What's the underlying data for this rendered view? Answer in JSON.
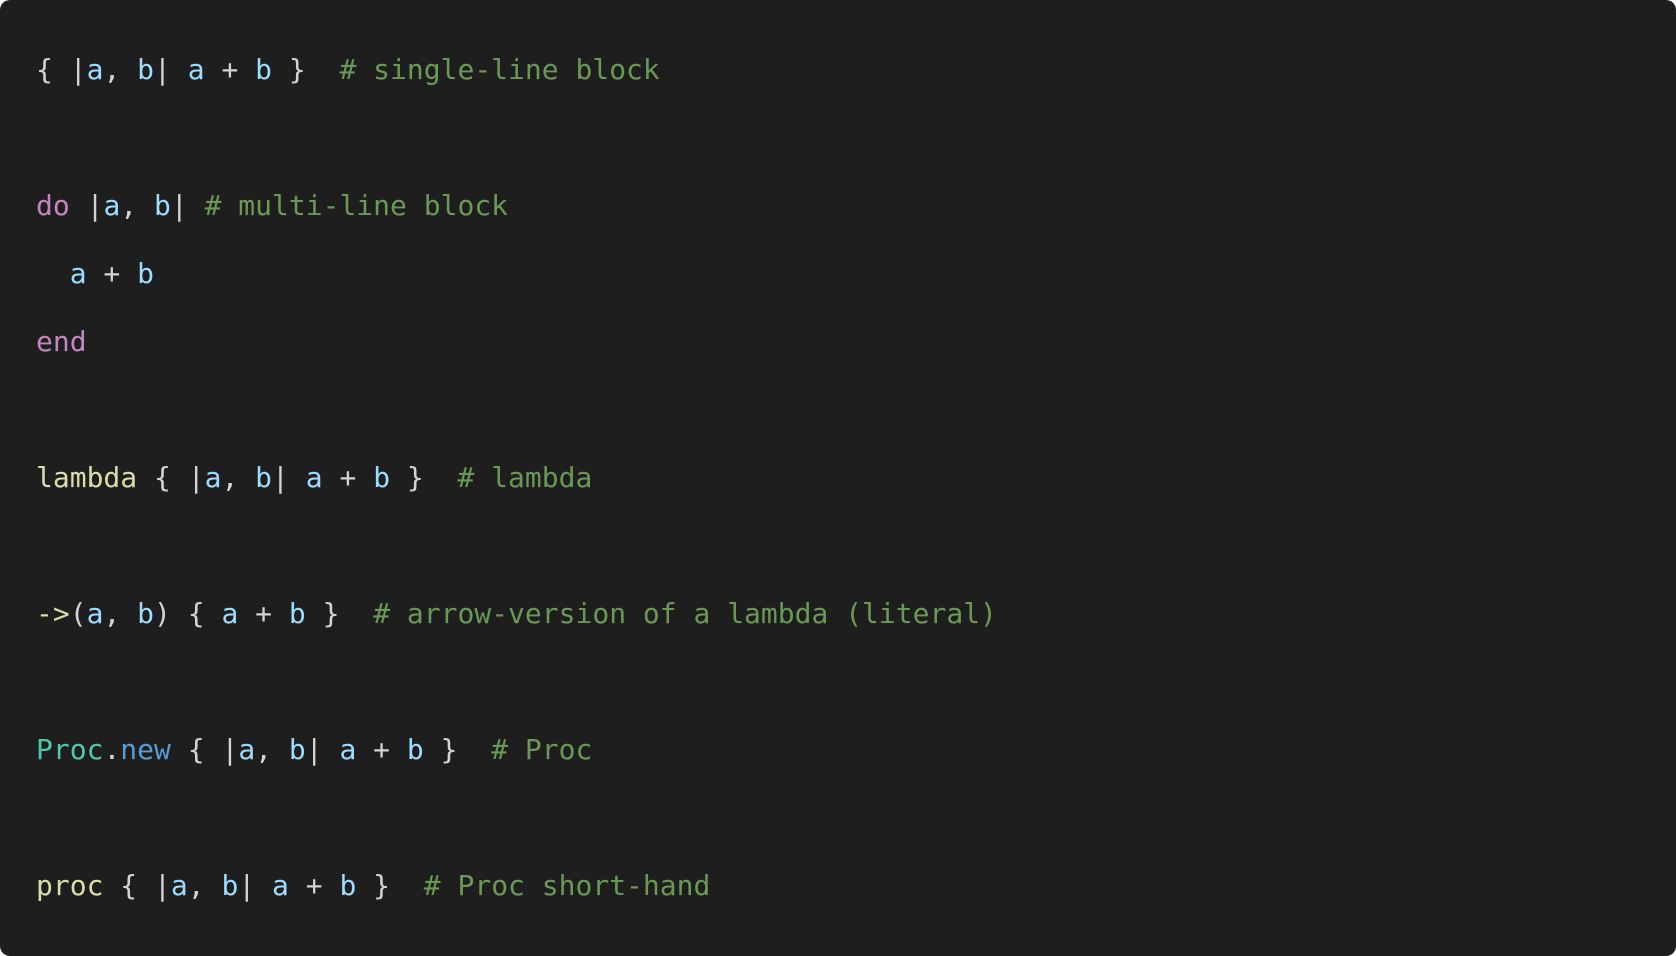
{
  "editor": {
    "language": "ruby",
    "theme_colors": {
      "background": "#1e1e1e",
      "punctuation": "#d4d4d4",
      "variable": "#9cdcfe",
      "comment": "#6a9955",
      "keyword": "#c586c0",
      "function": "#dcdcaa",
      "class": "#4ec9b0",
      "method": "#569cd6"
    },
    "lines": [
      {
        "tokens": [
          {
            "text": "{ |",
            "type": "punctuation"
          },
          {
            "text": "a",
            "type": "variable"
          },
          {
            "text": ", ",
            "type": "punctuation"
          },
          {
            "text": "b",
            "type": "variable"
          },
          {
            "text": "| ",
            "type": "punctuation"
          },
          {
            "text": "a",
            "type": "variable"
          },
          {
            "text": " + ",
            "type": "punctuation"
          },
          {
            "text": "b",
            "type": "variable"
          },
          {
            "text": " }  ",
            "type": "punctuation"
          },
          {
            "text": "# single-line block",
            "type": "comment"
          }
        ]
      },
      {
        "tokens": []
      },
      {
        "tokens": [
          {
            "text": "do",
            "type": "keyword"
          },
          {
            "text": " |",
            "type": "punctuation"
          },
          {
            "text": "a",
            "type": "variable"
          },
          {
            "text": ", ",
            "type": "punctuation"
          },
          {
            "text": "b",
            "type": "variable"
          },
          {
            "text": "| ",
            "type": "punctuation"
          },
          {
            "text": "# multi-line block",
            "type": "comment"
          }
        ]
      },
      {
        "tokens": [
          {
            "text": "  ",
            "type": "punctuation"
          },
          {
            "text": "a",
            "type": "variable"
          },
          {
            "text": " + ",
            "type": "punctuation"
          },
          {
            "text": "b",
            "type": "variable"
          }
        ]
      },
      {
        "tokens": [
          {
            "text": "end",
            "type": "keyword"
          }
        ]
      },
      {
        "tokens": []
      },
      {
        "tokens": [
          {
            "text": "lambda",
            "type": "function"
          },
          {
            "text": " { |",
            "type": "punctuation"
          },
          {
            "text": "a",
            "type": "variable"
          },
          {
            "text": ", ",
            "type": "punctuation"
          },
          {
            "text": "b",
            "type": "variable"
          },
          {
            "text": "| ",
            "type": "punctuation"
          },
          {
            "text": "a",
            "type": "variable"
          },
          {
            "text": " + ",
            "type": "punctuation"
          },
          {
            "text": "b",
            "type": "variable"
          },
          {
            "text": " }  ",
            "type": "punctuation"
          },
          {
            "text": "# lambda",
            "type": "comment"
          }
        ]
      },
      {
        "tokens": []
      },
      {
        "tokens": [
          {
            "text": "->",
            "type": "function"
          },
          {
            "text": "(",
            "type": "punctuation"
          },
          {
            "text": "a",
            "type": "variable"
          },
          {
            "text": ", ",
            "type": "punctuation"
          },
          {
            "text": "b",
            "type": "variable"
          },
          {
            "text": ") { ",
            "type": "punctuation"
          },
          {
            "text": "a",
            "type": "variable"
          },
          {
            "text": " + ",
            "type": "punctuation"
          },
          {
            "text": "b",
            "type": "variable"
          },
          {
            "text": " }  ",
            "type": "punctuation"
          },
          {
            "text": "# arrow-version of a lambda (literal)",
            "type": "comment"
          }
        ]
      },
      {
        "tokens": []
      },
      {
        "tokens": [
          {
            "text": "Proc",
            "type": "class"
          },
          {
            "text": ".",
            "type": "punctuation"
          },
          {
            "text": "new",
            "type": "method"
          },
          {
            "text": " { |",
            "type": "punctuation"
          },
          {
            "text": "a",
            "type": "variable"
          },
          {
            "text": ", ",
            "type": "punctuation"
          },
          {
            "text": "b",
            "type": "variable"
          },
          {
            "text": "| ",
            "type": "punctuation"
          },
          {
            "text": "a",
            "type": "variable"
          },
          {
            "text": " + ",
            "type": "punctuation"
          },
          {
            "text": "b",
            "type": "variable"
          },
          {
            "text": " }  ",
            "type": "punctuation"
          },
          {
            "text": "# Proc",
            "type": "comment"
          }
        ]
      },
      {
        "tokens": []
      },
      {
        "tokens": [
          {
            "text": "proc",
            "type": "function"
          },
          {
            "text": " { |",
            "type": "punctuation"
          },
          {
            "text": "a",
            "type": "variable"
          },
          {
            "text": ", ",
            "type": "punctuation"
          },
          {
            "text": "b",
            "type": "variable"
          },
          {
            "text": "| ",
            "type": "punctuation"
          },
          {
            "text": "a",
            "type": "variable"
          },
          {
            "text": " + ",
            "type": "punctuation"
          },
          {
            "text": "b",
            "type": "variable"
          },
          {
            "text": " }  ",
            "type": "punctuation"
          },
          {
            "text": "# Proc short-hand",
            "type": "comment"
          }
        ]
      }
    ]
  }
}
